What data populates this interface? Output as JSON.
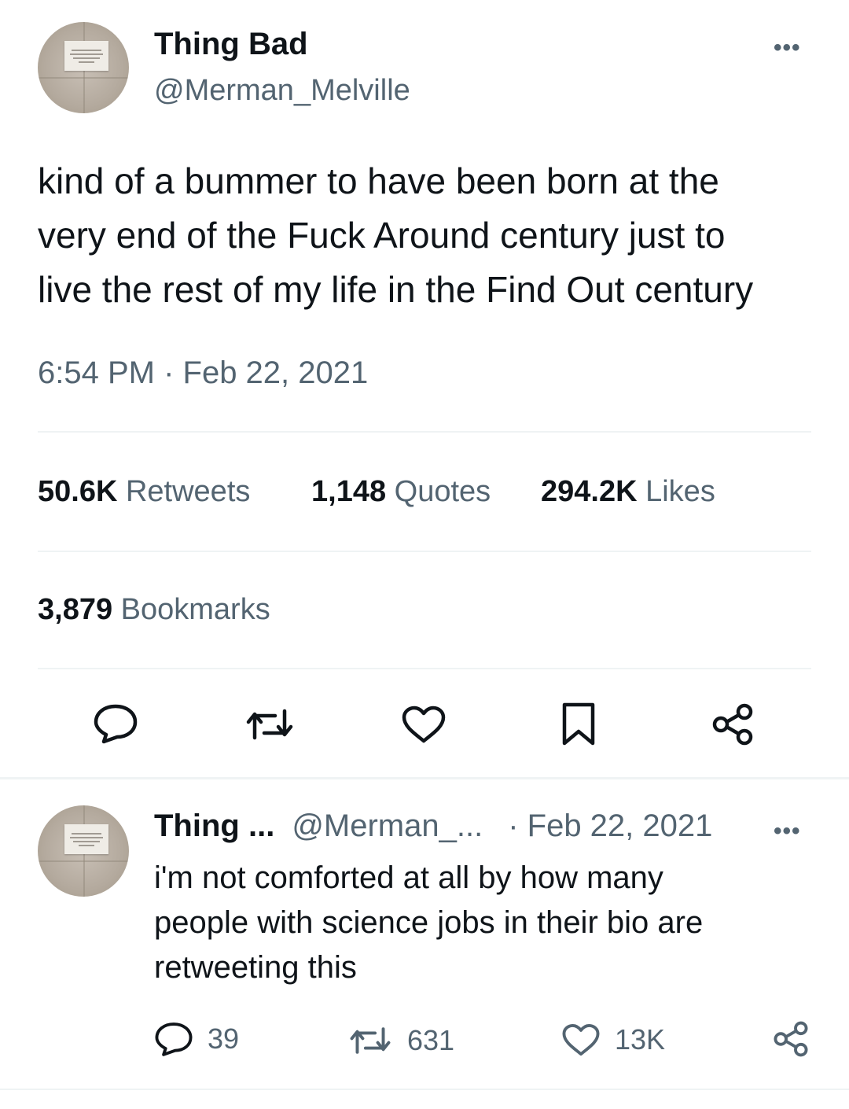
{
  "main_tweet": {
    "author": {
      "display_name": "Thing Bad",
      "handle": "@Merman_Melville",
      "avatar_icon": "avatar-photo"
    },
    "more_label": "•••",
    "text_lines": [
      "kind of a bummer to have been born at the",
      "very end of the Fuck Around century just to",
      "live the rest of my life in the Find Out century"
    ],
    "timestamp": "6:54 PM · Feb 22, 2021",
    "stats": {
      "retweets_count": "50.6K",
      "retweets_label": "Retweets",
      "quotes_count": "1,148",
      "quotes_label": "Quotes",
      "likes_count": "294.2K",
      "likes_label": "Likes",
      "bookmarks_count": "3,879",
      "bookmarks_label": "Bookmarks"
    },
    "actions": [
      "reply-icon",
      "retweet-icon",
      "like-icon",
      "bookmark-icon",
      "share-icon"
    ]
  },
  "reply": {
    "author": {
      "display_name": "Thing ...",
      "handle": "@Merman_...",
      "date": "· Feb 22, 2021"
    },
    "more_label": "•••",
    "text_lines": [
      "i'm not comforted at all by how many",
      "people with science jobs in their bio are",
      "retweeting this"
    ],
    "counts": {
      "replies": "39",
      "retweets": "631",
      "likes": "13K"
    }
  },
  "colors": {
    "primary_text": "#0f1419",
    "secondary_text": "#536471",
    "divider": "#eff3f4"
  }
}
